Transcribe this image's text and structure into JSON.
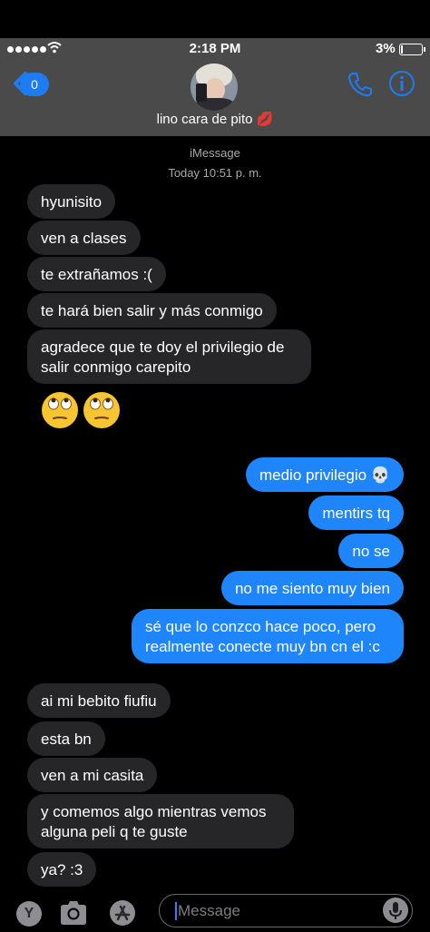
{
  "status_bar": {
    "time": "2:18 PM",
    "battery": "3%"
  },
  "header": {
    "back_count": "0",
    "contact_name": "lino cara de pito 💋"
  },
  "thread": {
    "service": "iMessage",
    "timestamp": "Today 10:51 p. m.",
    "messages": [
      {
        "from": "them",
        "text": "hyunisito"
      },
      {
        "from": "them",
        "text": "ven a clases"
      },
      {
        "from": "them",
        "text": "te extrañamos :("
      },
      {
        "from": "them",
        "text": "te hará bien salir y más conmigo"
      },
      {
        "from": "them",
        "text": "agradece que te doy el privilegio de salir conmigo carepito"
      },
      {
        "from": "them",
        "text": "🙄🙄"
      },
      {
        "from": "me",
        "text": "medio privilegio 💀"
      },
      {
        "from": "me",
        "text": "mentirs tq"
      },
      {
        "from": "me",
        "text": "no se"
      },
      {
        "from": "me",
        "text": "no me siento muy bien"
      },
      {
        "from": "me",
        "text": "sé que lo conzco hace poco, pero realmente conecte muy bn cn el :c"
      },
      {
        "from": "them",
        "text": "ai mi bebito fiufiu"
      },
      {
        "from": "them",
        "text": "esta bn"
      },
      {
        "from": "them",
        "text": "ven a mi casita"
      },
      {
        "from": "them",
        "text": "y comemos algo mientras vemos alguna peli q te guste"
      },
      {
        "from": "them",
        "text": "ya? :3"
      }
    ]
  },
  "composer": {
    "placeholder": "Message",
    "app_label": "Y"
  },
  "colors": {
    "outgoing": "#1f85fb",
    "incoming": "#262628",
    "header_bg": "#4a4a4a"
  }
}
